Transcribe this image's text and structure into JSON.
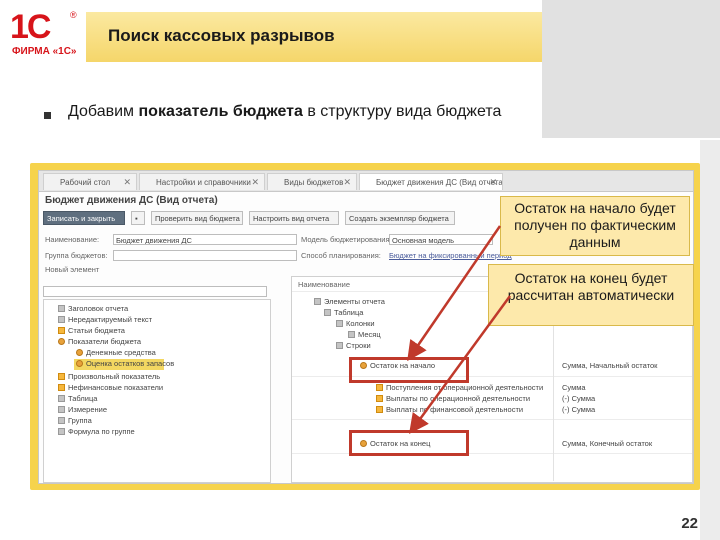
{
  "logo": {
    "mark": "1С",
    "reg": "®",
    "name": "ФИРМА «1С»"
  },
  "slide": {
    "title": "Поиск кассовых разрывов",
    "bullet_prefix": "Добавим ",
    "bullet_bold": "показатель бюджета",
    "bullet_suffix": " в структуру вида бюджета",
    "page_number": "22"
  },
  "callouts": {
    "start": "Остаток на начало будет получен по фактическим данным",
    "end": "Остаток на конец будет рассчитан автоматически"
  },
  "app": {
    "tabs": [
      {
        "label": "Рабочий стол"
      },
      {
        "label": "Настройки и справочники"
      },
      {
        "label": "Виды бюджетов"
      },
      {
        "label": "Бюджет движения ДС (Вид отчета)"
      }
    ],
    "form_title": "Бюджет движения ДС (Вид отчета)",
    "toolbar": {
      "save_close": "Записать и закрыть",
      "check": "Проверить вид бюджета",
      "setup": "Настроить вид отчета",
      "create": "Создать экземпляр бюджета"
    },
    "fields": {
      "name_label": "Наименование:",
      "name_value": "Бюджет движения ДС",
      "model_label": "Модель бюджетирования:",
      "model_value": "Основная модель",
      "group_label": "Группа бюджетов:",
      "method_label": "Способ планирования:",
      "method_value": "Бюджет на фиксированный период"
    },
    "left_tree": {
      "header": "Новый элемент",
      "items": [
        "Заголовок отчета",
        "Нередактируемый текст",
        "Статьи бюджета",
        "Показатели бюджета",
        "Денежные средства",
        "Оценка остатков запасов",
        "Произвольный показатель",
        "Нефинансовые показатели",
        "Таблица",
        "Измерение",
        "Группа",
        "Формула по группе"
      ]
    },
    "right_tree": {
      "header": "Наименование",
      "items": [
        "Элементы отчета",
        "Таблица",
        "Колонки",
        "Месяц",
        "Строки",
        "Остаток на начало",
        "Поступления от операционной деятельности",
        "Выплаты по операционной деятельности",
        "Выплаты по финансовой деятельности",
        "Остаток на конец"
      ],
      "col2": [
        "Сумма, Начальный остаток",
        "Сумма",
        "(-) Сумма",
        "(-) Сумма",
        "Сумма, Конечный остаток"
      ]
    }
  },
  "colors": {
    "accent_red": "#d7141a",
    "title_bar": "#f5d66a",
    "frame": "#f6d34c",
    "highlight": "#c0392b",
    "callout_bg": "#fde9ab"
  }
}
